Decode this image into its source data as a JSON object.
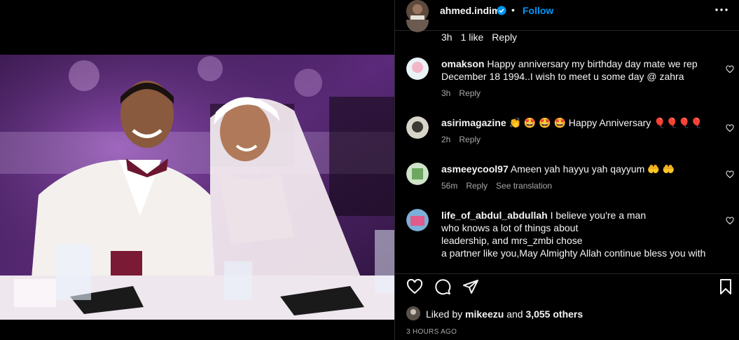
{
  "post": {
    "username": "ahmed.indimi",
    "follow_label": "Follow",
    "separator": "•",
    "image_alt": "Couple laughing at wedding reception table"
  },
  "top_comment_meta": {
    "time": "3h",
    "likes": "1 like",
    "reply": "Reply"
  },
  "comments": [
    {
      "username": "omakson",
      "text": "Happy anniversary my birthday day mate we rep December 18 1994..I wish to meet u some day @ zahra",
      "time": "3h",
      "reply": "Reply"
    },
    {
      "username": "asirimagazine",
      "text": "👏 🤩 🤩 🤩  Happy Anniversary 🎈🎈🎈🎈",
      "time": "2h",
      "reply": "Reply"
    },
    {
      "username": "asmeeycool97",
      "text": "Ameen yah hayyu yah qayyum 🤲 🤲",
      "time": "56m",
      "reply": "Reply",
      "translate": "See translation"
    },
    {
      "username": "life_of_abdul_abdullah",
      "text_lines": [
        "I believe you're a man",
        "who knows a lot of things about",
        "leadership, and mrs_zmbi chose",
        "a partner like you,May Almighty Allah continue bless you with"
      ]
    }
  ],
  "likes": {
    "prefix": "Liked by",
    "user": "mikeezu",
    "conj": "and",
    "others": "3,055 others"
  },
  "timestamp": "3 HOURS AGO",
  "icons": {
    "verified": "verified-badge-icon",
    "more": "more-options-icon",
    "heart": "heart-icon",
    "comment": "comment-icon",
    "share": "share-icon",
    "save": "bookmark-icon"
  },
  "colors": {
    "link": "#0095f6",
    "muted": "#a8a8a8",
    "border": "#262626"
  }
}
